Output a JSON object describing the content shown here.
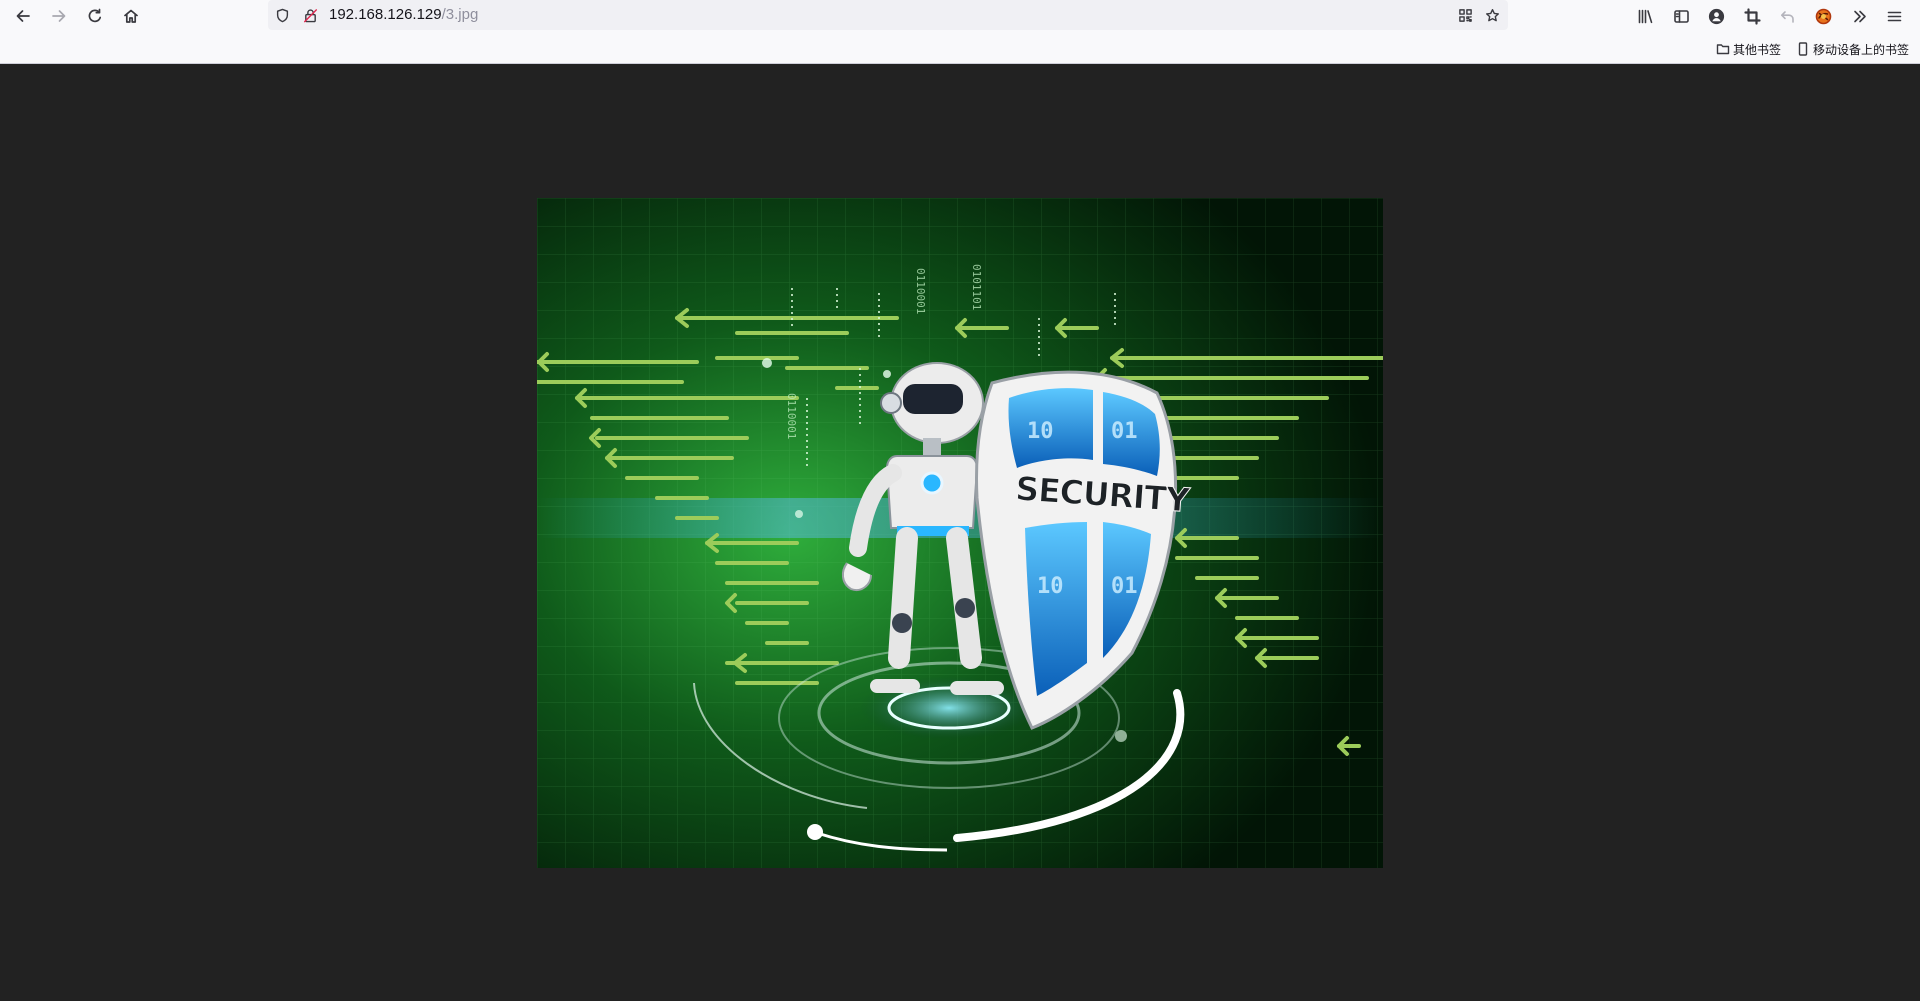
{
  "nav": {
    "back_icon": "arrow-left-icon",
    "forward_icon": "arrow-right-icon",
    "reload_icon": "reload-icon",
    "home_icon": "home-icon"
  },
  "urlbar": {
    "host": "192.168.126.129",
    "path": "/3.jpg",
    "shield_icon": "tracking-shield-icon",
    "lock_icon": "insecure-lock-icon",
    "qr_icon": "qr-code-icon",
    "star_icon": "bookmark-star-icon"
  },
  "toolbar": {
    "icons": [
      "library-icon",
      "sidebar-icon",
      "account-icon",
      "screenshot-crop-icon",
      "undo-icon",
      "extension-icon",
      "overflow-chevron-icon",
      "menu-hamburger-icon"
    ]
  },
  "bookmarks": {
    "other_bookmarks": "其他书签",
    "mobile_bookmarks": "移动设备上的书签"
  },
  "image": {
    "shield_text": "SECURITY",
    "binary_a": "0110001",
    "binary_b": "0101101",
    "binary_c": "10",
    "binary_d": "01",
    "colors": {
      "background": "#03200a",
      "glow": "#2fae3c",
      "arrows": "#9ccc5a",
      "shield_blue": "#1e8fe0",
      "robot": "#ececec"
    }
  }
}
